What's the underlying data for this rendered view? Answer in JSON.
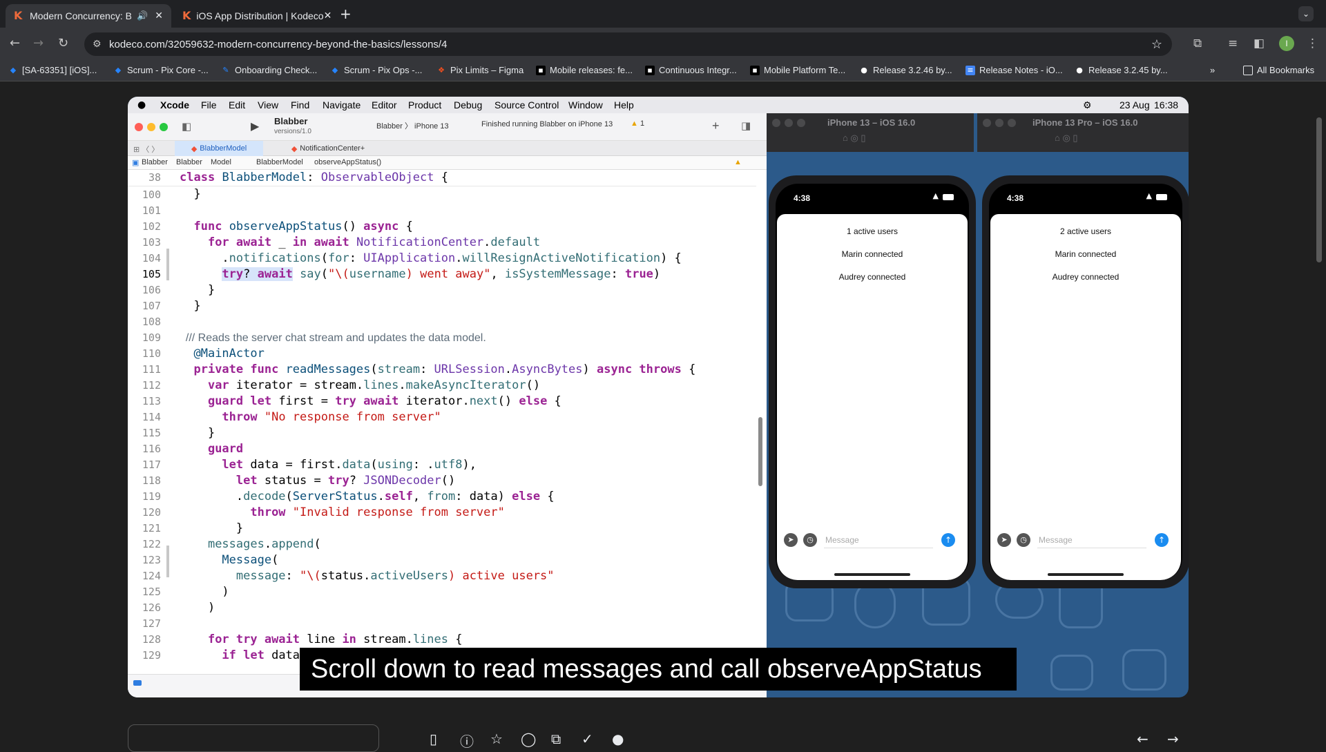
{
  "browser": {
    "tabs": [
      {
        "title": "Modern Concurrency: Be",
        "active": true
      },
      {
        "title": "iOS App Distribution | Kodeco",
        "active": false
      }
    ],
    "url": "kodeco.com/32059632-modern-concurrency-beyond-the-basics/lessons/4",
    "bookmarks": [
      "[SA-63351] [iOS]...",
      "Scrum - Pix Core -...",
      "Onboarding Check...",
      "Scrum - Pix Ops -...",
      "Pix Limits – Figma",
      "Mobile releases: fe...",
      "Continuous Integr...",
      "Mobile Platform Te...",
      "Release 3.2.46 by...",
      "Release Notes - iO...",
      "Release 3.2.45 by..."
    ],
    "all_bookmarks": "All Bookmarks",
    "profile_initial": "I"
  },
  "mac": {
    "menu": [
      "Xcode",
      "File",
      "Edit",
      "View",
      "Find",
      "Navigate",
      "Editor",
      "Product",
      "Debug",
      "Source Control",
      "Window",
      "Help"
    ],
    "date": "23 Aug",
    "time": "16:38"
  },
  "xcode": {
    "scheme": "Blabber",
    "scheme_sub": "versions/1.0",
    "target_app": "Blabber",
    "target_device": "iPhone 13",
    "status": "Finished running Blabber on iPhone 13",
    "warnings": "1",
    "tabs": [
      "BlabberModel",
      "NotificationCenter+"
    ],
    "breadcrumb": [
      "Blabber",
      "Blabber",
      "Model",
      "BlabberModel",
      "observeAppStatus()"
    ],
    "sticky_line": "38",
    "line_numbers": [
      "100",
      "101",
      "102",
      "103",
      "104",
      "105",
      "106",
      "107",
      "108",
      "109",
      "110",
      "111",
      "112",
      "113",
      "114",
      "115",
      "116",
      "117",
      "118",
      "119",
      "120",
      "121",
      "122",
      "123",
      "124",
      "125",
      "126",
      "127",
      "128",
      "129"
    ]
  },
  "simulators": [
    {
      "title": "iPhone 13 – iOS 16.0",
      "time": "4:38",
      "messages": [
        "1 active users",
        "Marin connected",
        "Audrey connected"
      ],
      "placeholder": "Message"
    },
    {
      "title": "iPhone 13 Pro – iOS 16.0",
      "time": "4:38",
      "messages": [
        "2 active users",
        "Marin connected",
        "Audrey connected"
      ],
      "placeholder": "Message"
    }
  ],
  "caption": "Scroll down to read messages and call observeAppStatus",
  "colors": {
    "keyword": "#9b2393",
    "string": "#c41a16",
    "type": "#0b4f79",
    "accent": "#1a8cf0",
    "kodeco": "#ef6a3b"
  }
}
